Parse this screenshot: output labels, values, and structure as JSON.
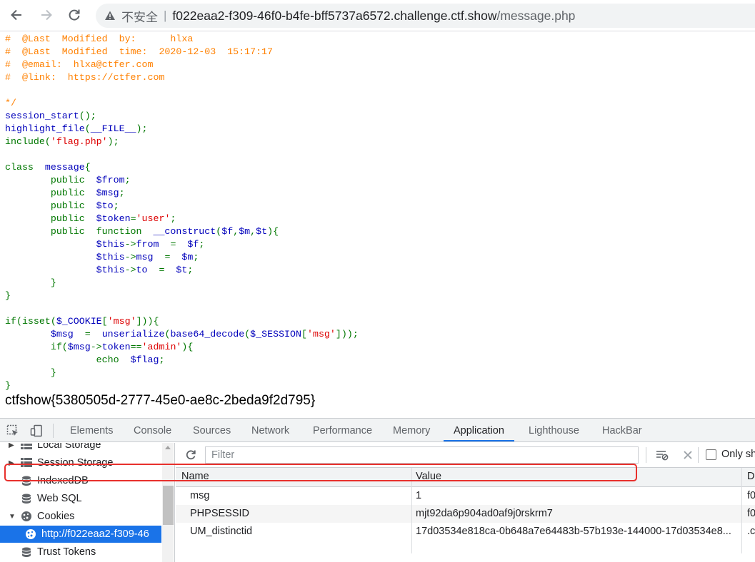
{
  "browser": {
    "insecure_label": "不安全",
    "separator": "|",
    "url_host": "f022eaa2-f309-46f0-b4fe-bff5737a6572.challenge.ctf.show",
    "url_path": "/message.php"
  },
  "code_lines": [
    [
      {
        "t": "#  @Last  Modified  by:      hlxa",
        "c": "c-comment"
      }
    ],
    [
      {
        "t": "#  @Last  Modified  time:  2020-12-03  15:17:17",
        "c": "c-comment"
      }
    ],
    [
      {
        "t": "#  @email:  hlxa@ctfer.com",
        "c": "c-comment"
      }
    ],
    [
      {
        "t": "#  @link:  https://ctfer.com",
        "c": "c-comment"
      }
    ],
    [
      {
        "t": "",
        "c": "c-comment"
      }
    ],
    [
      {
        "t": "*/",
        "c": "c-comment"
      }
    ],
    [
      {
        "t": "session_start",
        "c": "c-def"
      },
      {
        "t": "();",
        "c": "c-kw"
      }
    ],
    [
      {
        "t": "highlight_file",
        "c": "c-def"
      },
      {
        "t": "(",
        "c": "c-kw"
      },
      {
        "t": "__FILE__",
        "c": "c-def"
      },
      {
        "t": ");",
        "c": "c-kw"
      }
    ],
    [
      {
        "t": "include",
        "c": "c-kw"
      },
      {
        "t": "(",
        "c": "c-kw"
      },
      {
        "t": "'flag.php'",
        "c": "c-str"
      },
      {
        "t": ");",
        "c": "c-kw"
      }
    ],
    [
      {
        "t": "",
        "c": "c-kw"
      }
    ],
    [
      {
        "t": "class  ",
        "c": "c-kw"
      },
      {
        "t": "message",
        "c": "c-def"
      },
      {
        "t": "{",
        "c": "c-kw"
      }
    ],
    [
      {
        "t": "        public  ",
        "c": "c-kw"
      },
      {
        "t": "$from",
        "c": "c-def"
      },
      {
        "t": ";",
        "c": "c-kw"
      }
    ],
    [
      {
        "t": "        public  ",
        "c": "c-kw"
      },
      {
        "t": "$msg",
        "c": "c-def"
      },
      {
        "t": ";",
        "c": "c-kw"
      }
    ],
    [
      {
        "t": "        public  ",
        "c": "c-kw"
      },
      {
        "t": "$to",
        "c": "c-def"
      },
      {
        "t": ";",
        "c": "c-kw"
      }
    ],
    [
      {
        "t": "        public  ",
        "c": "c-kw"
      },
      {
        "t": "$token",
        "c": "c-def"
      },
      {
        "t": "=",
        "c": "c-kw"
      },
      {
        "t": "'user'",
        "c": "c-str"
      },
      {
        "t": ";",
        "c": "c-kw"
      }
    ],
    [
      {
        "t": "        public  function  ",
        "c": "c-kw"
      },
      {
        "t": "__construct",
        "c": "c-def"
      },
      {
        "t": "(",
        "c": "c-kw"
      },
      {
        "t": "$f",
        "c": "c-def"
      },
      {
        "t": ",",
        "c": "c-kw"
      },
      {
        "t": "$m",
        "c": "c-def"
      },
      {
        "t": ",",
        "c": "c-kw"
      },
      {
        "t": "$t",
        "c": "c-def"
      },
      {
        "t": "){",
        "c": "c-kw"
      }
    ],
    [
      {
        "t": "                ",
        "c": "c-kw"
      },
      {
        "t": "$this",
        "c": "c-def"
      },
      {
        "t": "->",
        "c": "c-kw"
      },
      {
        "t": "from  ",
        "c": "c-def"
      },
      {
        "t": "=  ",
        "c": "c-kw"
      },
      {
        "t": "$f",
        "c": "c-def"
      },
      {
        "t": ";",
        "c": "c-kw"
      }
    ],
    [
      {
        "t": "                ",
        "c": "c-kw"
      },
      {
        "t": "$this",
        "c": "c-def"
      },
      {
        "t": "->",
        "c": "c-kw"
      },
      {
        "t": "msg  ",
        "c": "c-def"
      },
      {
        "t": "=  ",
        "c": "c-kw"
      },
      {
        "t": "$m",
        "c": "c-def"
      },
      {
        "t": ";",
        "c": "c-kw"
      }
    ],
    [
      {
        "t": "                ",
        "c": "c-kw"
      },
      {
        "t": "$this",
        "c": "c-def"
      },
      {
        "t": "->",
        "c": "c-kw"
      },
      {
        "t": "to  ",
        "c": "c-def"
      },
      {
        "t": "=  ",
        "c": "c-kw"
      },
      {
        "t": "$t",
        "c": "c-def"
      },
      {
        "t": ";",
        "c": "c-kw"
      }
    ],
    [
      {
        "t": "        }",
        "c": "c-kw"
      }
    ],
    [
      {
        "t": "}",
        "c": "c-kw"
      }
    ],
    [
      {
        "t": "",
        "c": "c-kw"
      }
    ],
    [
      {
        "t": "if(isset(",
        "c": "c-kw"
      },
      {
        "t": "$_COOKIE",
        "c": "c-def"
      },
      {
        "t": "[",
        "c": "c-kw"
      },
      {
        "t": "'msg'",
        "c": "c-str"
      },
      {
        "t": "])){",
        "c": "c-kw"
      }
    ],
    [
      {
        "t": "        ",
        "c": "c-kw"
      },
      {
        "t": "$msg  ",
        "c": "c-def"
      },
      {
        "t": "=  ",
        "c": "c-kw"
      },
      {
        "t": "unserialize",
        "c": "c-def"
      },
      {
        "t": "(",
        "c": "c-kw"
      },
      {
        "t": "base64_decode",
        "c": "c-def"
      },
      {
        "t": "(",
        "c": "c-kw"
      },
      {
        "t": "$_SESSION",
        "c": "c-def"
      },
      {
        "t": "[",
        "c": "c-kw"
      },
      {
        "t": "'msg'",
        "c": "c-str"
      },
      {
        "t": "]));",
        "c": "c-kw"
      }
    ],
    [
      {
        "t": "        if(",
        "c": "c-kw"
      },
      {
        "t": "$msg",
        "c": "c-def"
      },
      {
        "t": "->",
        "c": "c-kw"
      },
      {
        "t": "token",
        "c": "c-def"
      },
      {
        "t": "==",
        "c": "c-kw"
      },
      {
        "t": "'admin'",
        "c": "c-str"
      },
      {
        "t": "){",
        "c": "c-kw"
      }
    ],
    [
      {
        "t": "                echo  ",
        "c": "c-kw"
      },
      {
        "t": "$flag",
        "c": "c-def"
      },
      {
        "t": ";",
        "c": "c-kw"
      }
    ],
    [
      {
        "t": "        }",
        "c": "c-kw"
      }
    ],
    [
      {
        "t": "}",
        "c": "c-kw"
      }
    ]
  ],
  "flag_output": "ctfshow{5380505d-2777-45e0-ae8c-2beda9f2d795}",
  "devtools": {
    "tabs": [
      "Elements",
      "Console",
      "Sources",
      "Network",
      "Performance",
      "Memory",
      "Application",
      "Lighthouse",
      "HackBar"
    ],
    "active_tab": "Application",
    "sidebar": [
      {
        "label": "Local Storage",
        "expand": "▶",
        "icon": "grid"
      },
      {
        "label": "Session Storage",
        "expand": "▶",
        "icon": "grid"
      },
      {
        "label": "IndexedDB",
        "expand": "",
        "icon": "db"
      },
      {
        "label": "Web SQL",
        "expand": "",
        "icon": "db"
      },
      {
        "label": "Cookies",
        "expand": "▼",
        "icon": "cookie"
      },
      {
        "label": "http://f022eaa2-f309-46",
        "expand": "",
        "icon": "cookie",
        "selected": true
      },
      {
        "label": "Trust Tokens",
        "expand": "",
        "icon": "db"
      }
    ],
    "filter_placeholder": "Filter",
    "only_show_label": "Only sh",
    "columns": {
      "name": "Name",
      "value": "Value",
      "domain": "D"
    },
    "cookies": [
      {
        "name": "msg",
        "value": "1",
        "domain": "f0"
      },
      {
        "name": "PHPSESSID",
        "value": "mjt92da6p904ad0af9j0rskrm7",
        "domain": "f0"
      },
      {
        "name": "UM_distinctid",
        "value": "17d03534e818ca-0b648a7e64483b-57b193e-144000-17d03534e8...",
        "domain": ".c"
      }
    ]
  }
}
